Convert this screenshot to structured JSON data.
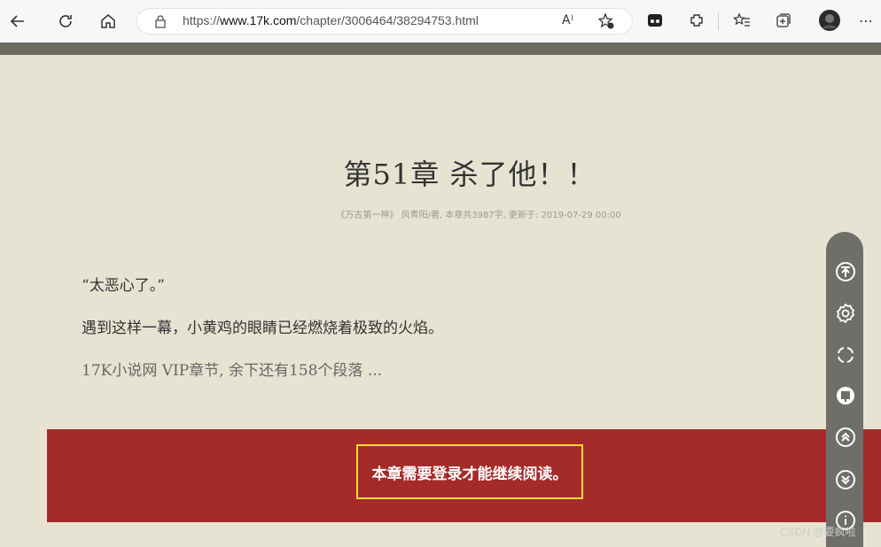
{
  "browser": {
    "url_prefix": "https://",
    "url_host": "www.17k.com",
    "url_path": "/chapter/3006464/38294753.html",
    "read_aloud_label": "A⁾"
  },
  "chapter": {
    "title": "第51章  杀了他！！",
    "meta": "《万古第一神》 风青阳/著, 本章共3987字, 更新于: 2019-07-29 00:00",
    "paragraphs": [
      "“太恶心了。”",
      "遇到这样一幕，小黄鸡的眼睛已经燃烧着极致的火焰。",
      "17K小说网 VIP章节, 余下还有158个段落 ..."
    ]
  },
  "login_prompt": "本章需要登录才能继续阅读。",
  "watermark": "CSDN @要疯啦",
  "colors": {
    "page_bg": "#e6e3d2",
    "login_band": "#a52a2a",
    "highlight_border": "#ffe02a",
    "float_panel": "#6f6f69"
  },
  "icons": [
    "back-icon",
    "refresh-icon",
    "home-icon",
    "lock-icon",
    "read-aloud-icon",
    "add-favorite-icon",
    "collections-icon",
    "extensions-icon",
    "favorites-icon",
    "tab-groups-icon",
    "profile-icon",
    "more-icon",
    "scroll-top-icon",
    "settings-icon",
    "fullscreen-icon",
    "reader-mode-icon",
    "prev-chapter-icon",
    "next-chapter-icon",
    "info-icon"
  ]
}
